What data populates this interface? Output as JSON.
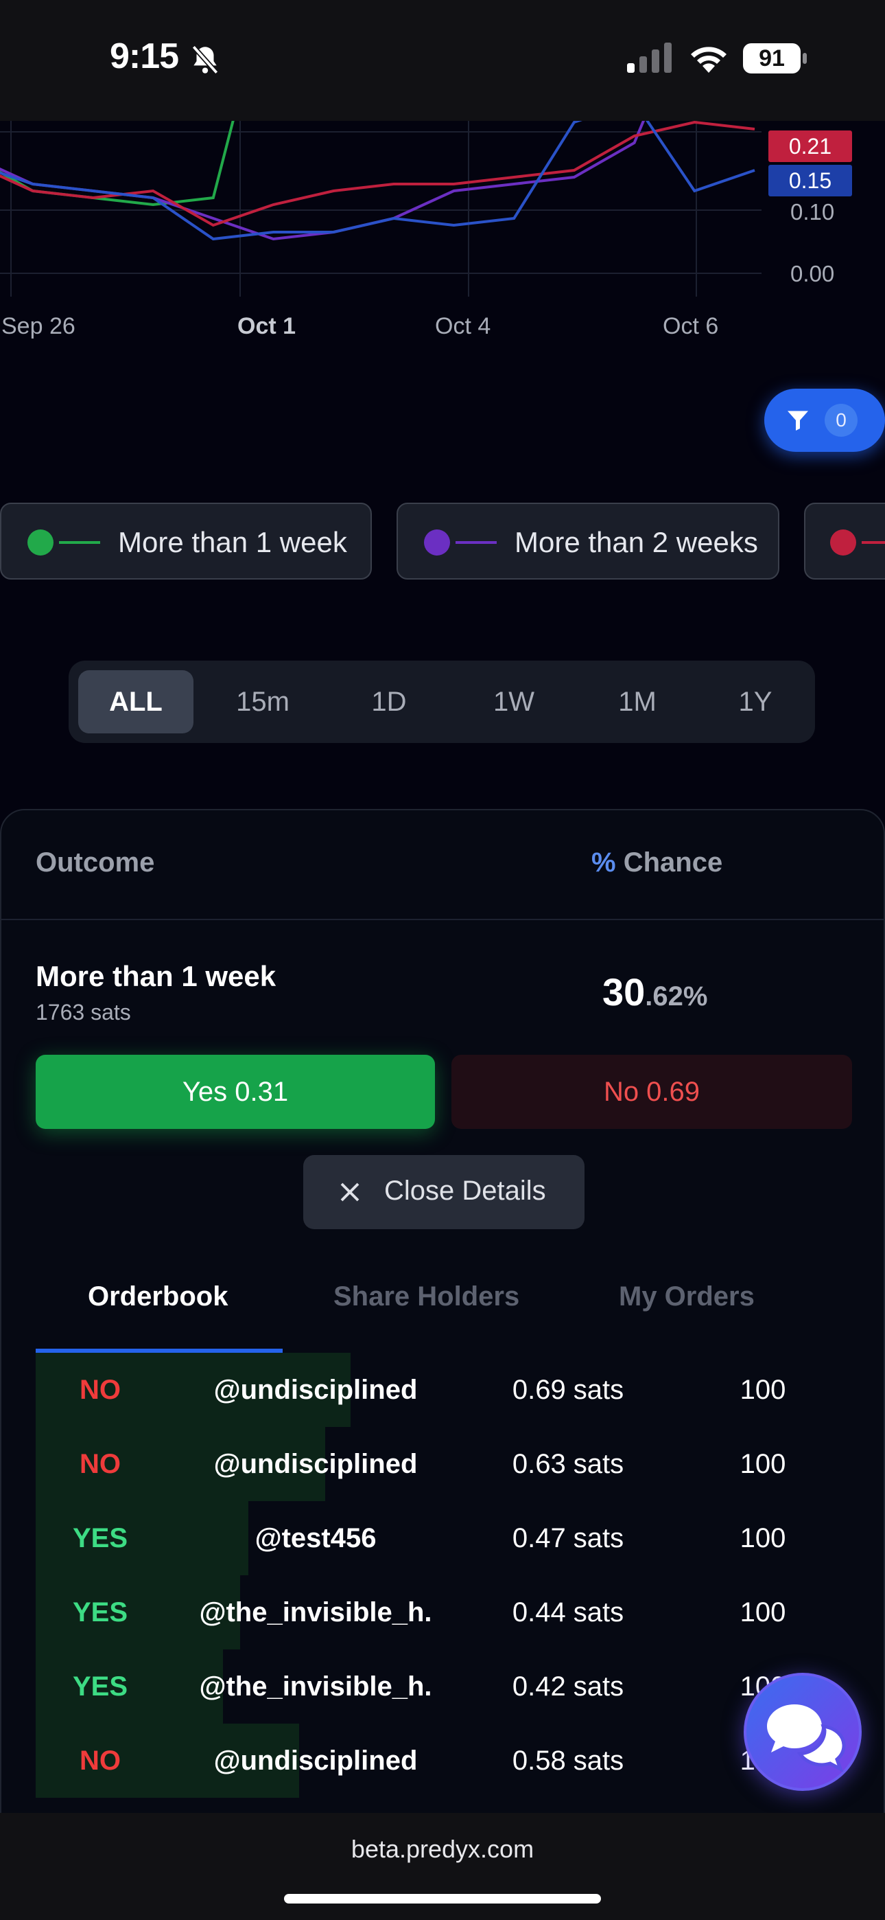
{
  "status_bar": {
    "time": "9:15",
    "battery": "91",
    "icons": [
      "bell-slash-icon",
      "cellular-signal-icon",
      "wifi-icon",
      "battery-icon"
    ]
  },
  "chart": {
    "x_ticks": [
      "Sep 26",
      "Oct 1",
      "Oct 4",
      "Oct 6"
    ],
    "y_ticks": [
      "0.10",
      "0.00"
    ],
    "value_tags": [
      {
        "value": "0.21",
        "color": "#c0203e"
      },
      {
        "value": "0.15",
        "color": "#1d3fa8"
      }
    ]
  },
  "chart_data": {
    "type": "line",
    "x": [
      "Sep 24",
      "Sep 25",
      "Sep 26",
      "Sep 27",
      "Sep 28",
      "Sep 29",
      "Sep 30",
      "Oct 1",
      "Oct 2",
      "Oct 3",
      "Oct 4",
      "Oct 5",
      "Oct 6",
      "Oct 7"
    ],
    "series": [
      {
        "color": "#22a94a",
        "values": [
          0.17,
          0.12,
          0.11,
          0.1,
          0.11,
          0.45,
          null,
          null,
          null,
          null,
          null,
          null,
          null,
          null
        ]
      },
      {
        "color": "#6b2fc2",
        "values": [
          0.17,
          0.13,
          0.12,
          0.11,
          0.08,
          0.05,
          0.06,
          0.08,
          0.12,
          0.13,
          0.14,
          0.19,
          0.4,
          0.3
        ]
      },
      {
        "color": "#c0203e",
        "values": [
          0.16,
          0.12,
          0.11,
          0.12,
          0.07,
          0.1,
          0.12,
          0.13,
          0.13,
          0.14,
          0.15,
          0.2,
          0.22,
          0.21
        ]
      },
      {
        "color": "#2a52c8",
        "values": [
          0.16,
          0.13,
          0.12,
          0.11,
          0.05,
          0.06,
          0.06,
          0.08,
          0.07,
          0.08,
          0.22,
          0.25,
          0.12,
          0.15
        ]
      }
    ],
    "ylim": [
      0.0,
      0.3
    ]
  },
  "filter": {
    "count": "0"
  },
  "legend": [
    {
      "label": "More than 1 week",
      "color": "#22a94a"
    },
    {
      "label": "More than 2 weeks",
      "color": "#6b2fc2"
    },
    {
      "label": "",
      "color": "#c0203e"
    }
  ],
  "range_tabs": [
    {
      "label": "ALL",
      "active": true
    },
    {
      "label": "15m",
      "active": false
    },
    {
      "label": "1D",
      "active": false
    },
    {
      "label": "1W",
      "active": false
    },
    {
      "label": "1M",
      "active": false
    },
    {
      "label": "1Y",
      "active": false
    }
  ],
  "table_header": {
    "outcome": "Outcome",
    "chance_symbol": "%",
    "chance": " Chance"
  },
  "outcome": {
    "name": "More than 1 week",
    "sats": "1763 sats",
    "chance_int": "30",
    "chance_dec": ".62%",
    "yes_label": "Yes 0.31",
    "no_label": "No 0.69",
    "close_label": "Close Details"
  },
  "tabs": [
    {
      "label": "Orderbook",
      "active": true
    },
    {
      "label": "Share Holders",
      "active": false
    },
    {
      "label": "My Orders",
      "active": false
    }
  ],
  "orderbook": [
    {
      "side": "NO",
      "user": "@undisciplined",
      "price": "0.69 sats",
      "qty": "100",
      "depth": 0.37
    },
    {
      "side": "NO",
      "user": "@undisciplined",
      "price": "0.63 sats",
      "qty": "100",
      "depth": 0.34
    },
    {
      "side": "YES",
      "user": "@test456",
      "price": "0.47 sats",
      "qty": "100",
      "depth": 0.25
    },
    {
      "side": "YES",
      "user": "@the_invisible_h.",
      "price": "0.44 sats",
      "qty": "100",
      "depth": 0.24
    },
    {
      "side": "YES",
      "user": "@the_invisible_h.",
      "price": "0.42 sats",
      "qty": "100",
      "depth": 0.22
    },
    {
      "side": "NO",
      "user": "@undisciplined",
      "price": "0.58 sats",
      "qty": "100",
      "depth": 0.31
    }
  ],
  "colors": {
    "yes": "#3ddc84",
    "no": "#ef3b3b",
    "accent": "#2563eb"
  },
  "url": "beta.predyx.com"
}
